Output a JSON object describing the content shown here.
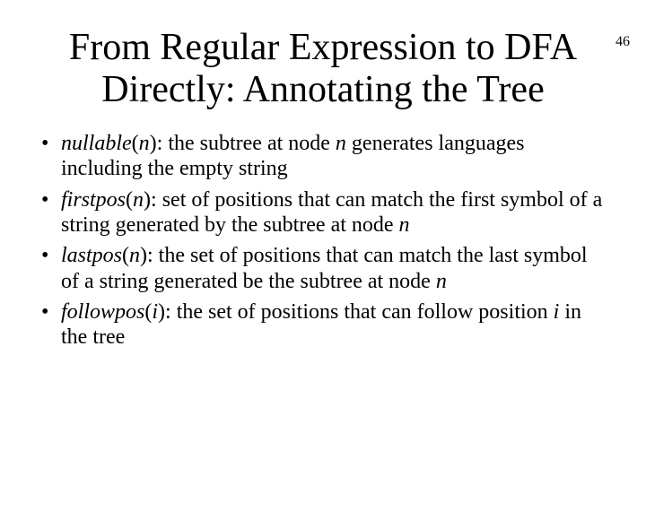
{
  "page_number": "46",
  "title": "From Regular Expression to DFA Directly: Annotating the Tree",
  "bullets": [
    {
      "term": "nullable",
      "arg": "n",
      "desc_a": ": the subtree at node ",
      "var_a": "n",
      "desc_b": " generates languages including the empty string"
    },
    {
      "term": "firstpos",
      "arg": "n",
      "desc_a": ": set of positions that can match the first symbol of a string generated by the subtree at node ",
      "var_a": "n",
      "desc_b": ""
    },
    {
      "term": "lastpos",
      "arg": "n",
      "desc_a": ": the set of positions that can match the last symbol of a string generated be the subtree at node ",
      "var_a": "n",
      "desc_b": ""
    },
    {
      "term": "followpos",
      "arg": "i",
      "desc_a": ": the set of positions that can follow position ",
      "var_a": "i",
      "desc_b": " in the tree"
    }
  ]
}
